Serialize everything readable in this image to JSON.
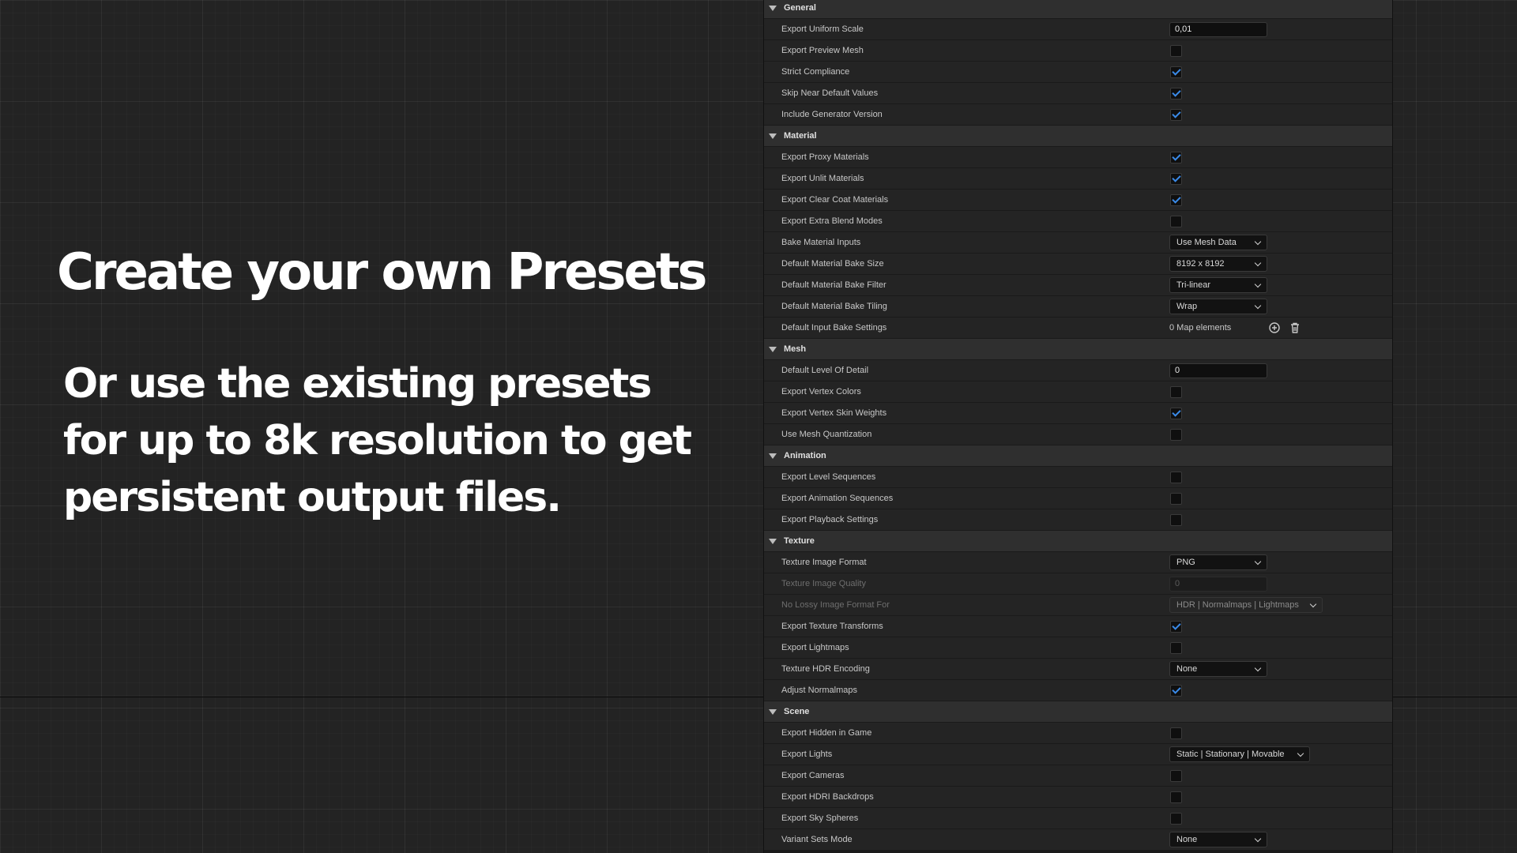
{
  "promo": {
    "title": "Create your own Presets",
    "subtitle": "Or use the existing presets for up to 8k resolution to get persistent output files."
  },
  "colors": {
    "check_accent": "#3a8ae8",
    "panel_bg": "#1a1a1a",
    "row_bg": "#242424",
    "header_bg": "#2f2f2f"
  },
  "icons": [
    "chevron-down-icon",
    "add-circle-icon",
    "trash-icon",
    "checkmark-icon"
  ],
  "categories": {
    "general": {
      "name": "General",
      "export_uniform_scale": {
        "label": "Export Uniform Scale",
        "value": "0,01"
      },
      "export_preview_mesh": {
        "label": "Export Preview Mesh",
        "checked": false
      },
      "strict_compliance": {
        "label": "Strict Compliance",
        "checked": true
      },
      "skip_near_default_values": {
        "label": "Skip Near Default Values",
        "checked": true
      },
      "include_generator_version": {
        "label": "Include Generator Version",
        "checked": true
      }
    },
    "material": {
      "name": "Material",
      "export_proxy_materials": {
        "label": "Export Proxy Materials",
        "checked": true
      },
      "export_unlit_materials": {
        "label": "Export Unlit Materials",
        "checked": true
      },
      "export_clear_coat_materials": {
        "label": "Export Clear Coat Materials",
        "checked": true
      },
      "export_extra_blend_modes": {
        "label": "Export Extra Blend Modes",
        "checked": false
      },
      "bake_material_inputs": {
        "label": "Bake Material Inputs",
        "value": "Use Mesh Data"
      },
      "default_material_bake_size": {
        "label": "Default Material Bake Size",
        "value": "8192 x 8192"
      },
      "default_material_bake_filter": {
        "label": "Default Material Bake Filter",
        "value": "Tri-linear"
      },
      "default_material_bake_tiling": {
        "label": "Default Material Bake Tiling",
        "value": "Wrap"
      },
      "default_input_bake_settings": {
        "label": "Default Input Bake Settings",
        "value": "0 Map elements"
      }
    },
    "mesh": {
      "name": "Mesh",
      "default_level_of_detail": {
        "label": "Default Level Of Detail",
        "value": "0"
      },
      "export_vertex_colors": {
        "label": "Export Vertex Colors",
        "checked": false
      },
      "export_vertex_skin_weights": {
        "label": "Export Vertex Skin Weights",
        "checked": true
      },
      "use_mesh_quantization": {
        "label": "Use Mesh Quantization",
        "checked": false
      }
    },
    "animation": {
      "name": "Animation",
      "export_level_sequences": {
        "label": "Export Level Sequences",
        "checked": false
      },
      "export_animation_sequences": {
        "label": "Export Animation Sequences",
        "checked": false
      },
      "export_playback_settings": {
        "label": "Export Playback Settings",
        "checked": false
      }
    },
    "texture": {
      "name": "Texture",
      "texture_image_format": {
        "label": "Texture Image Format",
        "value": "PNG"
      },
      "texture_image_quality": {
        "label": "Texture Image Quality",
        "value": "0",
        "disabled": true
      },
      "no_lossy_image_format_for": {
        "label": "No Lossy Image Format For",
        "value": "HDR | Normalmaps | Lightmaps",
        "disabled": true
      },
      "export_texture_transforms": {
        "label": "Export Texture Transforms",
        "checked": true
      },
      "export_lightmaps": {
        "label": "Export Lightmaps",
        "checked": false
      },
      "texture_hdr_encoding": {
        "label": "Texture HDR Encoding",
        "value": "None"
      },
      "adjust_normalmaps": {
        "label": "Adjust Normalmaps",
        "checked": true
      }
    },
    "scene": {
      "name": "Scene",
      "export_hidden_in_game": {
        "label": "Export Hidden in Game",
        "checked": false
      },
      "export_lights": {
        "label": "Export Lights",
        "value": "Static | Stationary | Movable"
      },
      "export_cameras": {
        "label": "Export Cameras",
        "checked": false
      },
      "export_hdri_backdrops": {
        "label": "Export HDRI Backdrops",
        "checked": false
      },
      "export_sky_spheres": {
        "label": "Export Sky Spheres",
        "checked": false
      },
      "variant_sets_mode": {
        "label": "Variant Sets Mode",
        "value": "None"
      }
    }
  }
}
